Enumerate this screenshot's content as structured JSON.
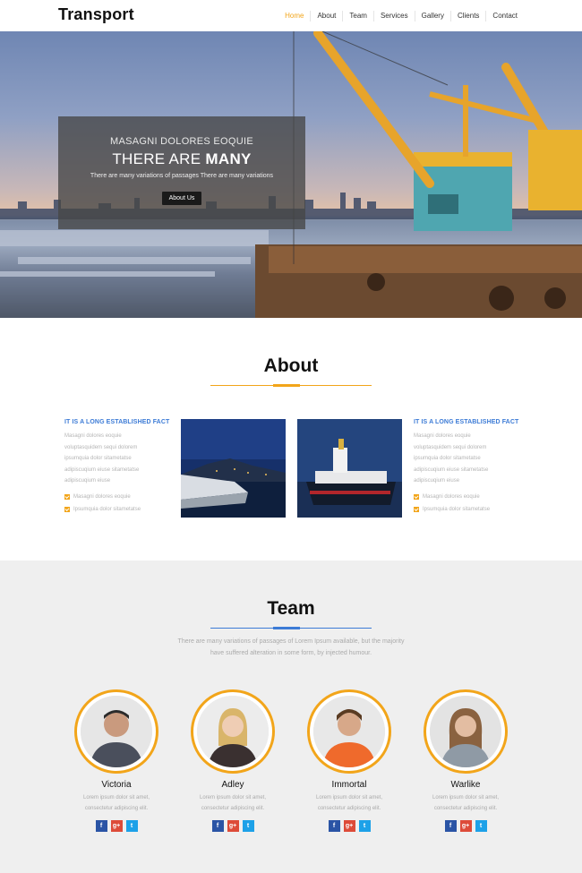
{
  "header": {
    "logo": "Transport",
    "nav": [
      "Home",
      "About",
      "Team",
      "Services",
      "Gallery",
      "Clients",
      "Contact"
    ]
  },
  "hero": {
    "subtitle": "MASAGNI DOLORES EOQUIE",
    "title_lead": "THERE ARE",
    "title_bold": "MANY",
    "text": "There are many variations of passages There are many variations",
    "button": "About Us"
  },
  "about": {
    "title": "About",
    "left": {
      "heading": "IT IS A LONG ESTABLISHED FACT",
      "lines": [
        "Masagni dolores eoquie",
        "voluptasquidem sequi dolorem",
        "ipsumquia dolor sitametatse",
        "adipiscuqium eiuse sitametatse",
        "adipiscuqium eiuse"
      ],
      "checks": [
        "Masagni dolores eoquie",
        "Ipsumquia dolor sitametatse"
      ]
    },
    "right": {
      "heading": "IT IS A LONG ESTABLISHED FACT",
      "lines": [
        "Masagni dolores eoquie",
        "voluptasquidem sequi dolorem",
        "ipsumquia dolor sitametatse",
        "adipiscuqium eiuse sitametatse",
        "adipiscuqium eiuse"
      ],
      "checks": [
        "Masagni dolores eoquie",
        "Ipsumquia dolor sitametatse"
      ]
    }
  },
  "team": {
    "title": "Team",
    "description": "There are many variations of passages of Lorem Ipsum available, but the majority have suffered alteration in some form, by injected humour.",
    "members": [
      {
        "name": "Victoria",
        "text1": "Lorem ipsum dolor sit amet,",
        "text2": "consectetur adipiscing elit."
      },
      {
        "name": "Adley",
        "text1": "Lorem ipsum dolor sit amet,",
        "text2": "consectetur adipiscing elit."
      },
      {
        "name": "Immortal",
        "text1": "Lorem ipsum dolor sit amet,",
        "text2": "consectetur adipiscing elit."
      },
      {
        "name": "Warlike",
        "text1": "Lorem ipsum dolor sit amet,",
        "text2": "consectetur adipiscing elit."
      }
    ],
    "socials": {
      "facebook": "f",
      "google": "g+",
      "twitter": "t"
    }
  },
  "colors": {
    "accent": "#f2a51a",
    "blue": "#3c7bd6",
    "facebook": "#2a54a5",
    "google": "#dd4b39",
    "twitter": "#1da1e8"
  }
}
